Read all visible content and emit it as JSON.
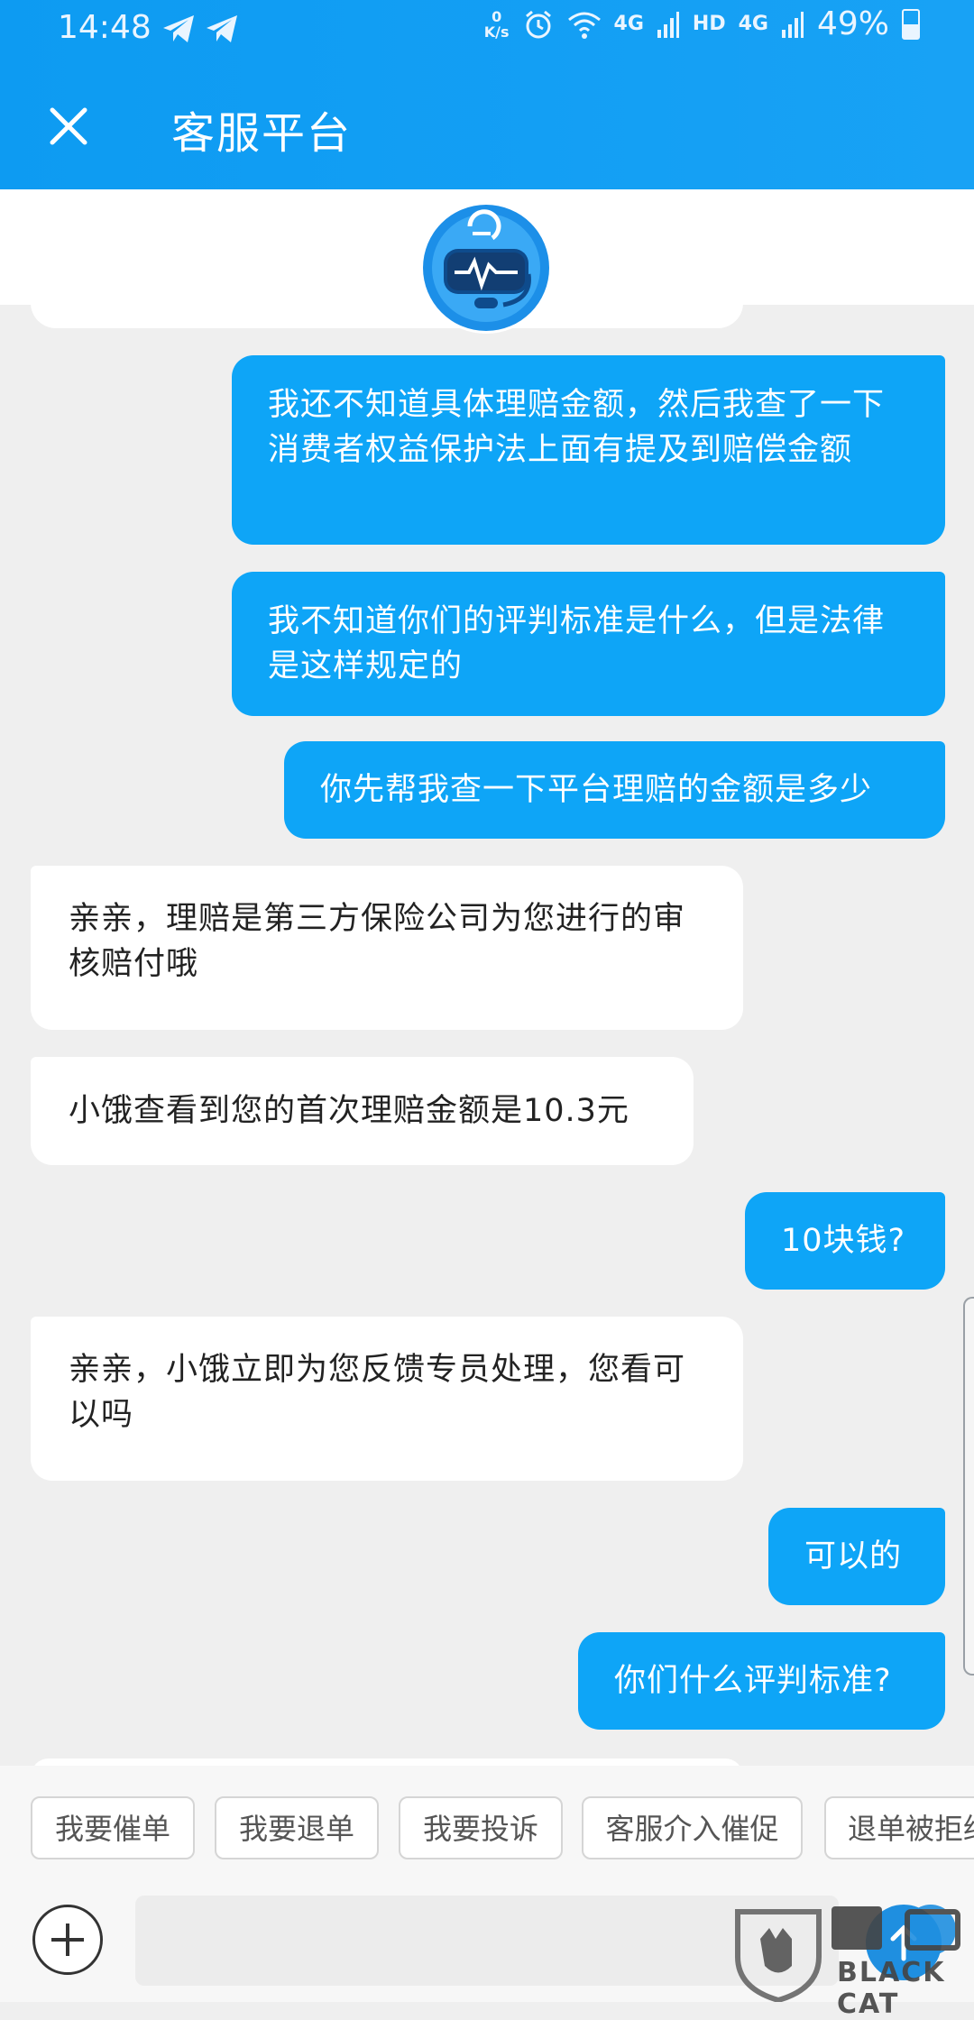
{
  "status_bar": {
    "time": "14:48",
    "net_speed_value": "0",
    "net_speed_unit": "K/s",
    "signal_1_label": "4G",
    "hd_label": "HD",
    "signal_2_label": "4G",
    "battery": "49%"
  },
  "header": {
    "title": "客服平台"
  },
  "messages": [
    {
      "side": "right",
      "text": "我还不知道具体理赔金额，然后我查了一下消费者权益保护法上面有提及到赔偿金额"
    },
    {
      "side": "right",
      "text": "我不知道你们的评判标准是什么，但是法律是这样规定的"
    },
    {
      "side": "right",
      "text": "你先帮我查一下平台理赔的金额是多少"
    },
    {
      "side": "left",
      "text": "亲亲，理赔是第三方保险公司为您进行的审核赔付哦"
    },
    {
      "side": "left",
      "text": "小饿查看到您的首次理赔金额是10.3元"
    },
    {
      "side": "right",
      "text": "10块钱?"
    },
    {
      "side": "left",
      "text": "亲亲，小饿立即为您反馈专员处理，您看可以吗"
    },
    {
      "side": "right",
      "text": "可以的"
    },
    {
      "side": "right",
      "text": "你们什么评判标准?"
    }
  ],
  "quick_replies": [
    "我要催单",
    "我要退单",
    "我要投诉",
    "客服介入催促",
    "退单被拒绝"
  ],
  "input": {
    "placeholder": ""
  },
  "watermark": {
    "text": "BLACK CAT"
  },
  "colors": {
    "header": "#0d9bf2",
    "user_bubble": "#0ea5f7",
    "agent_bubble": "#ffffff",
    "background": "#efefef"
  },
  "icons": {
    "close": "close-icon",
    "plus": "plus-icon",
    "send": "send-icon",
    "avatar": "robot-avatar-icon"
  }
}
